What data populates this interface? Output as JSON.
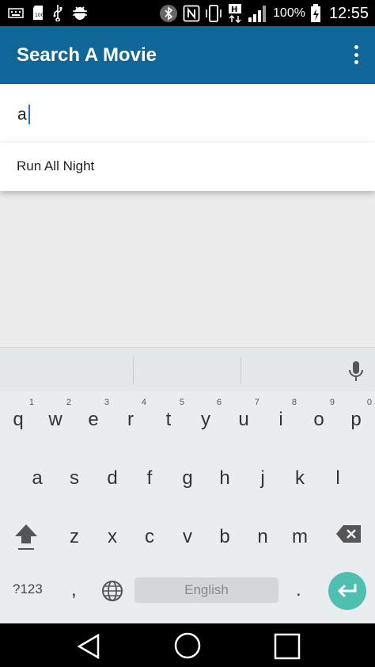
{
  "status_bar": {
    "battery": "100%",
    "time": "12:55",
    "icons": [
      "keyboard-icon",
      "sd-card-icon",
      "usb-icon",
      "android-debug-icon",
      "bluetooth-icon",
      "nfc-icon",
      "vibrate-icon",
      "signal-h-icon",
      "signal-bars-icon",
      "battery-charging-icon"
    ]
  },
  "app_bar": {
    "title": "Search A Movie",
    "overflow_icon": "more-vert-icon",
    "color": "#0f6699"
  },
  "search": {
    "value": "a"
  },
  "suggestions": [
    "Run All Night"
  ],
  "keyboard": {
    "row1": [
      {
        "letter": "q",
        "hint": "1"
      },
      {
        "letter": "w",
        "hint": "2"
      },
      {
        "letter": "e",
        "hint": "3"
      },
      {
        "letter": "r",
        "hint": "4"
      },
      {
        "letter": "t",
        "hint": "5"
      },
      {
        "letter": "y",
        "hint": "6"
      },
      {
        "letter": "u",
        "hint": "7"
      },
      {
        "letter": "i",
        "hint": "8"
      },
      {
        "letter": "o",
        "hint": "9"
      },
      {
        "letter": "p",
        "hint": "0"
      }
    ],
    "row2": [
      "a",
      "s",
      "d",
      "f",
      "g",
      "h",
      "j",
      "k",
      "l"
    ],
    "row3": [
      "z",
      "x",
      "c",
      "v",
      "b",
      "n",
      "m"
    ],
    "symbols_label": "?123",
    "comma": ",",
    "space_label": "English",
    "period": ".",
    "enter_color": "#4fbfb0"
  },
  "nav_bar": {
    "icons": [
      "back-icon",
      "home-icon",
      "recents-icon"
    ]
  }
}
